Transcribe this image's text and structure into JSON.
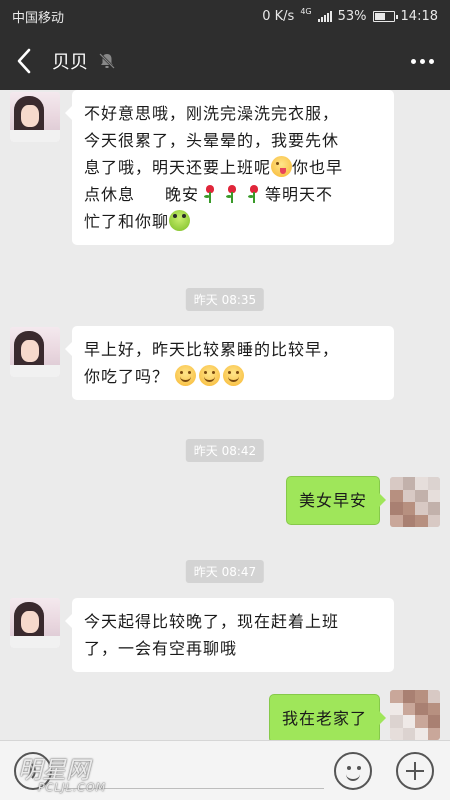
{
  "status_bar": {
    "carrier": "中国移动",
    "speed": "0 K/s",
    "network": "4G",
    "battery": "53%",
    "battery_level": 0.53,
    "time": "14:18"
  },
  "nav": {
    "title": "贝贝",
    "icons": {
      "back": "back-arrow-icon",
      "mute": "mute-bell-icon",
      "more": "more-icon"
    }
  },
  "messages": [
    {
      "side": "in",
      "text_lines": [
        "不好意思哦，刚洗完澡洗完衣服，",
        "今天很累了，头晕晕的，我要先休",
        "息了哦，明天还要上班呢",
        "点休息",
        "等明天不",
        "忙了和你聊"
      ],
      "after_line3": "你也早",
      "after_line4": "晚安"
    },
    {
      "side": "time",
      "text": "昨天 08:35"
    },
    {
      "side": "in",
      "text_lines": [
        "早上好，昨天比较累睡的比较早，",
        "你吃了吗？"
      ]
    },
    {
      "side": "time",
      "text": "昨天 08:42"
    },
    {
      "side": "out",
      "text": "美女早安"
    },
    {
      "side": "time",
      "text": "昨天 08:47"
    },
    {
      "side": "in",
      "text_lines": [
        "今天起得比较晚了，现在赶着上班",
        "了，一会有空再聊哦"
      ]
    },
    {
      "side": "out",
      "text": "我在老家了"
    }
  ],
  "input_bar": {
    "icons": {
      "voice": "voice-icon",
      "emoji": "emoji-icon",
      "add": "plus-icon"
    }
  },
  "watermark": {
    "main": "明星网",
    "sub": "PCLJL.COM"
  },
  "colors": {
    "header_bg": "#2e2e2e",
    "chat_bg": "#ebebeb",
    "out_bubble": "#9fe65a",
    "in_bubble": "#ffffff"
  }
}
